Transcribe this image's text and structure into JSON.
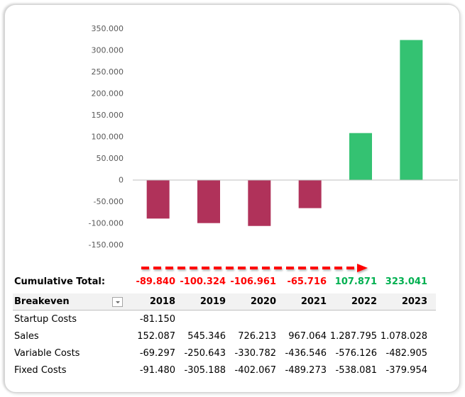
{
  "colors": {
    "negative_bar": "#B0325A",
    "positive_bar": "#34C272",
    "negative_text": "#FF0000",
    "positive_text": "#00B050",
    "arrow": "#FF0000",
    "axis_line": "#BFBFBF",
    "tick_text": "#595959"
  },
  "chart_data": {
    "type": "bar",
    "title": "",
    "xlabel": "",
    "ylabel": "",
    "categories": [
      "2018",
      "2019",
      "2020",
      "2021",
      "2022",
      "2023"
    ],
    "values": [
      -89840,
      -100324,
      -106961,
      -65716,
      107871,
      323041
    ],
    "ylim": [
      -150000,
      350000
    ],
    "yticks": [
      350000,
      300000,
      250000,
      200000,
      150000,
      100000,
      50000,
      0,
      -50000,
      -100000,
      -150000
    ],
    "ytick_labels": [
      "350.000",
      "300.000",
      "250.000",
      "200.000",
      "150.000",
      "100.000",
      "50.000",
      "0",
      "-50.000",
      "-100.000",
      "-150.000"
    ],
    "grid": false,
    "legend": "none",
    "annotation": "dashed red arrow pointing right toward breakeven year"
  },
  "table": {
    "cumulative_label": "Cumulative Total:",
    "cumulative_values": [
      "-89.840",
      "-100.324",
      "-106.961",
      "-65.716",
      "107.871",
      "323.041"
    ],
    "header_label": "Breakeven",
    "years": [
      "2018",
      "2019",
      "2020",
      "2021",
      "2022",
      "2023"
    ],
    "rows": [
      {
        "label": "Startup Costs",
        "values": [
          "-81.150",
          "",
          "",
          "",
          "",
          ""
        ]
      },
      {
        "label": "Sales",
        "values": [
          "152.087",
          "545.346",
          "726.213",
          "967.064",
          "1.287.795",
          "1.078.028"
        ]
      },
      {
        "label": "Variable Costs",
        "values": [
          "-69.297",
          "-250.643",
          "-330.782",
          "-436.546",
          "-576.126",
          "-482.905"
        ]
      },
      {
        "label": "Fixed Costs",
        "values": [
          "-91.480",
          "-305.188",
          "-402.067",
          "-489.273",
          "-538.081",
          "-379.954"
        ]
      }
    ]
  }
}
